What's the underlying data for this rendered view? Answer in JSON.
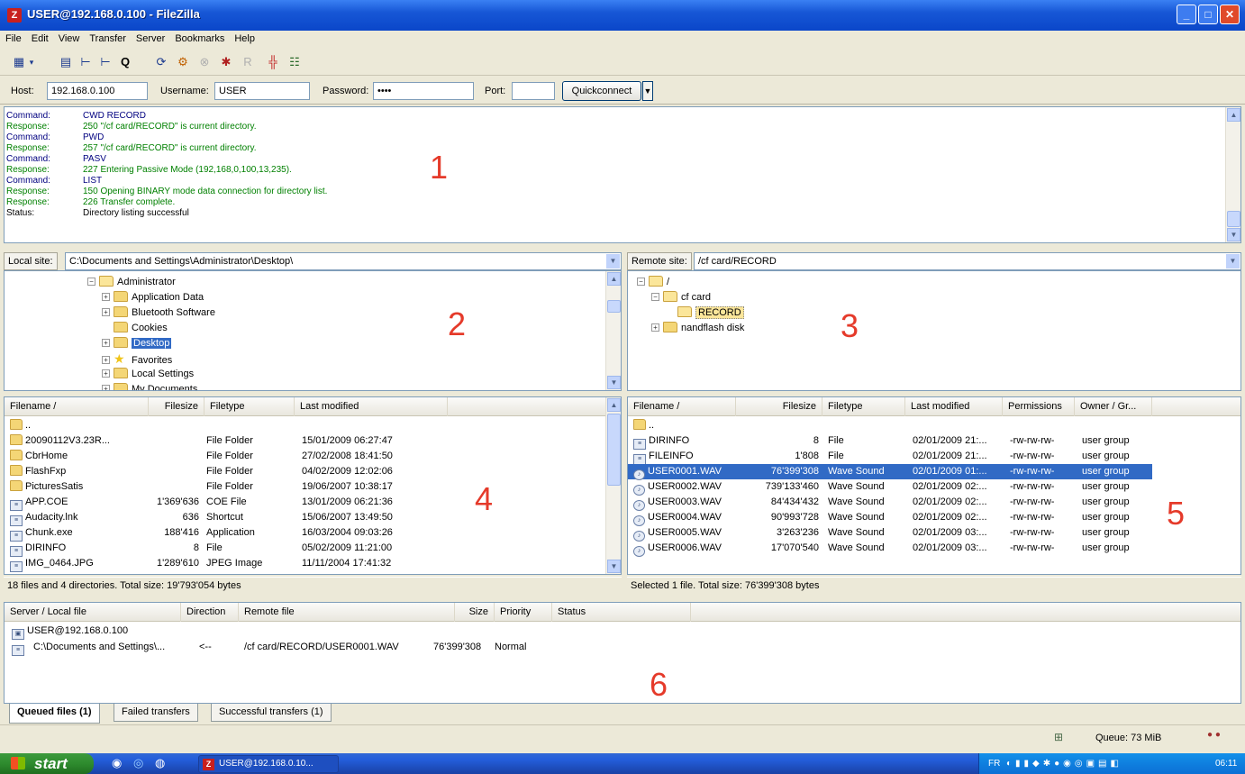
{
  "window": {
    "title": "USER@192.168.0.100 - FileZilla",
    "app_icon": "Z"
  },
  "menu": [
    "File",
    "Edit",
    "View",
    "Transfer",
    "Server",
    "Bookmarks",
    "Help"
  ],
  "quickconnect": {
    "host_label": "Host:",
    "host_value": "192.168.0.100",
    "username_label": "Username:",
    "username_value": "USER",
    "password_label": "Password:",
    "password_value": "••••",
    "port_label": "Port:",
    "port_value": "",
    "button_label": "Quickconnect"
  },
  "log": [
    {
      "k": "Command:",
      "v": "CWD RECORD",
      "t": "cmd"
    },
    {
      "k": "Response:",
      "v": "250 \"/cf card/RECORD\" is current directory.",
      "t": "resp"
    },
    {
      "k": "Command:",
      "v": "PWD",
      "t": "cmd"
    },
    {
      "k": "Response:",
      "v": "257 \"/cf card/RECORD\" is current directory.",
      "t": "resp"
    },
    {
      "k": "Command:",
      "v": "PASV",
      "t": "cmd"
    },
    {
      "k": "Response:",
      "v": "227 Entering Passive Mode (192,168,0,100,13,235).",
      "t": "resp"
    },
    {
      "k": "Command:",
      "v": "LIST",
      "t": "cmd"
    },
    {
      "k": "Response:",
      "v": "150 Opening BINARY mode data connection for directory list.",
      "t": "resp"
    },
    {
      "k": "Response:",
      "v": "226 Transfer complete.",
      "t": "resp"
    },
    {
      "k": "Status:",
      "v": "Directory listing successful",
      "t": "stat"
    }
  ],
  "annotations": [
    "1",
    "2",
    "3",
    "4",
    "5",
    "6"
  ],
  "local_site": {
    "label": "Local site:",
    "path": "C:\\Documents and Settings\\Administrator\\Desktop\\",
    "tree": [
      {
        "name": "Administrator",
        "indent": 0,
        "exp": "−",
        "icon": "folder-open"
      },
      {
        "name": "Application Data",
        "indent": 1,
        "exp": "+",
        "icon": "folder"
      },
      {
        "name": "Bluetooth Software",
        "indent": 1,
        "exp": "+",
        "icon": "folder"
      },
      {
        "name": "Cookies",
        "indent": 1,
        "exp": "",
        "icon": "folder"
      },
      {
        "name": "Desktop",
        "indent": 1,
        "exp": "+",
        "icon": "folder",
        "sel": true
      },
      {
        "name": "Favorites",
        "indent": 1,
        "exp": "+",
        "icon": "star"
      },
      {
        "name": "Local Settings",
        "indent": 1,
        "exp": "+",
        "icon": "folder"
      },
      {
        "name": "My Documents",
        "indent": 1,
        "exp": "+",
        "icon": "folder"
      }
    ],
    "columns": [
      "Filename  /",
      "Filesize",
      "Filetype",
      "Last modified"
    ],
    "files": [
      {
        "name": "..",
        "size": "",
        "type": "",
        "modified": "",
        "icon": "fold"
      },
      {
        "name": "20090112V3.23R...",
        "size": "",
        "type": "File Folder",
        "modified": "15/01/2009 06:27:47",
        "icon": "fold"
      },
      {
        "name": "CbrHome",
        "size": "",
        "type": "File Folder",
        "modified": "27/02/2008 18:41:50",
        "icon": "fold"
      },
      {
        "name": "FlashFxp",
        "size": "",
        "type": "File Folder",
        "modified": "04/02/2009 12:02:06",
        "icon": "fold"
      },
      {
        "name": "PicturesSatis",
        "size": "",
        "type": "File Folder",
        "modified": "19/06/2007 10:38:17",
        "icon": "fold"
      },
      {
        "name": "APP.COE",
        "size": "1'369'636",
        "type": "COE File",
        "modified": "13/01/2009 06:21:36",
        "icon": "file"
      },
      {
        "name": "Audacity.lnk",
        "size": "636",
        "type": "Shortcut",
        "modified": "15/06/2007 13:49:50",
        "icon": "file"
      },
      {
        "name": "Chunk.exe",
        "size": "188'416",
        "type": "Application",
        "modified": "16/03/2004 09:03:26",
        "icon": "file"
      },
      {
        "name": "DIRINFO",
        "size": "8",
        "type": "File",
        "modified": "05/02/2009 11:21:00",
        "icon": "file"
      },
      {
        "name": "IMG_0464.JPG",
        "size": "1'289'610",
        "type": "JPEG Image",
        "modified": "11/11/2004 17:41:32",
        "icon": "file"
      }
    ],
    "status": "18 files and 4 directories. Total size: 19'793'054 bytes"
  },
  "remote_site": {
    "label": "Remote site:",
    "path": "/cf card/RECORD",
    "tree": [
      {
        "name": "/",
        "indent": 0,
        "exp": "−",
        "icon": "folder-open"
      },
      {
        "name": "cf card",
        "indent": 1,
        "exp": "−",
        "icon": "folder-open"
      },
      {
        "name": "RECORD",
        "indent": 2,
        "exp": "",
        "icon": "folder-open",
        "hl": true
      },
      {
        "name": "nandflash disk",
        "indent": 1,
        "exp": "+",
        "icon": "folder"
      }
    ],
    "columns": [
      "Filename  /",
      "Filesize",
      "Filetype",
      "Last modified",
      "Permissions",
      "Owner / Gr..."
    ],
    "files": [
      {
        "name": "..",
        "size": "",
        "type": "",
        "modified": "",
        "perm": "",
        "owner": "",
        "icon": "fold"
      },
      {
        "name": "DIRINFO",
        "size": "8",
        "type": "File",
        "modified": "02/01/2009 21:...",
        "perm": "-rw-rw-rw-",
        "owner": "user group",
        "icon": "file"
      },
      {
        "name": "FILEINFO",
        "size": "1'808",
        "type": "File",
        "modified": "02/01/2009 21:...",
        "perm": "-rw-rw-rw-",
        "owner": "user group",
        "icon": "file"
      },
      {
        "name": "USER0001.WAV",
        "size": "76'399'308",
        "type": "Wave Sound",
        "modified": "02/01/2009 01:...",
        "perm": "-rw-rw-rw-",
        "owner": "user group",
        "icon": "wav",
        "sel": true
      },
      {
        "name": "USER0002.WAV",
        "size": "739'133'460",
        "type": "Wave Sound",
        "modified": "02/01/2009 02:...",
        "perm": "-rw-rw-rw-",
        "owner": "user group",
        "icon": "wav"
      },
      {
        "name": "USER0003.WAV",
        "size": "84'434'432",
        "type": "Wave Sound",
        "modified": "02/01/2009 02:...",
        "perm": "-rw-rw-rw-",
        "owner": "user group",
        "icon": "wav"
      },
      {
        "name": "USER0004.WAV",
        "size": "90'993'728",
        "type": "Wave Sound",
        "modified": "02/01/2009 02:...",
        "perm": "-rw-rw-rw-",
        "owner": "user group",
        "icon": "wav"
      },
      {
        "name": "USER0005.WAV",
        "size": "3'263'236",
        "type": "Wave Sound",
        "modified": "02/01/2009 03:...",
        "perm": "-rw-rw-rw-",
        "owner": "user group",
        "icon": "wav"
      },
      {
        "name": "USER0006.WAV",
        "size": "17'070'540",
        "type": "Wave Sound",
        "modified": "02/01/2009 03:...",
        "perm": "-rw-rw-rw-",
        "owner": "user group",
        "icon": "wav"
      }
    ],
    "status": "Selected 1 file. Total size: 76'399'308 bytes"
  },
  "queue": {
    "columns": [
      "Server / Local file",
      "Direction",
      "Remote file",
      "Size",
      "Priority",
      "Status"
    ],
    "server": "USER@192.168.0.100",
    "item": {
      "local": "C:\\Documents and Settings\\...",
      "direction": "<--",
      "remote": "/cf card/RECORD/USER0001.WAV",
      "size": "76'399'308",
      "priority": "Normal"
    }
  },
  "tabs": [
    "Queued files (1)",
    "Failed transfers",
    "Successful transfers (1)"
  ],
  "statusbar": {
    "queue": "Queue: 73 MiB"
  },
  "taskbar": {
    "start": "start",
    "app": "USER@192.168.0.10...",
    "lang": "FR",
    "clock": "06:11"
  },
  "colors": {
    "selection": "#316ac5",
    "command": "#000080",
    "response": "#008000",
    "annotation": "#e53a2a"
  }
}
